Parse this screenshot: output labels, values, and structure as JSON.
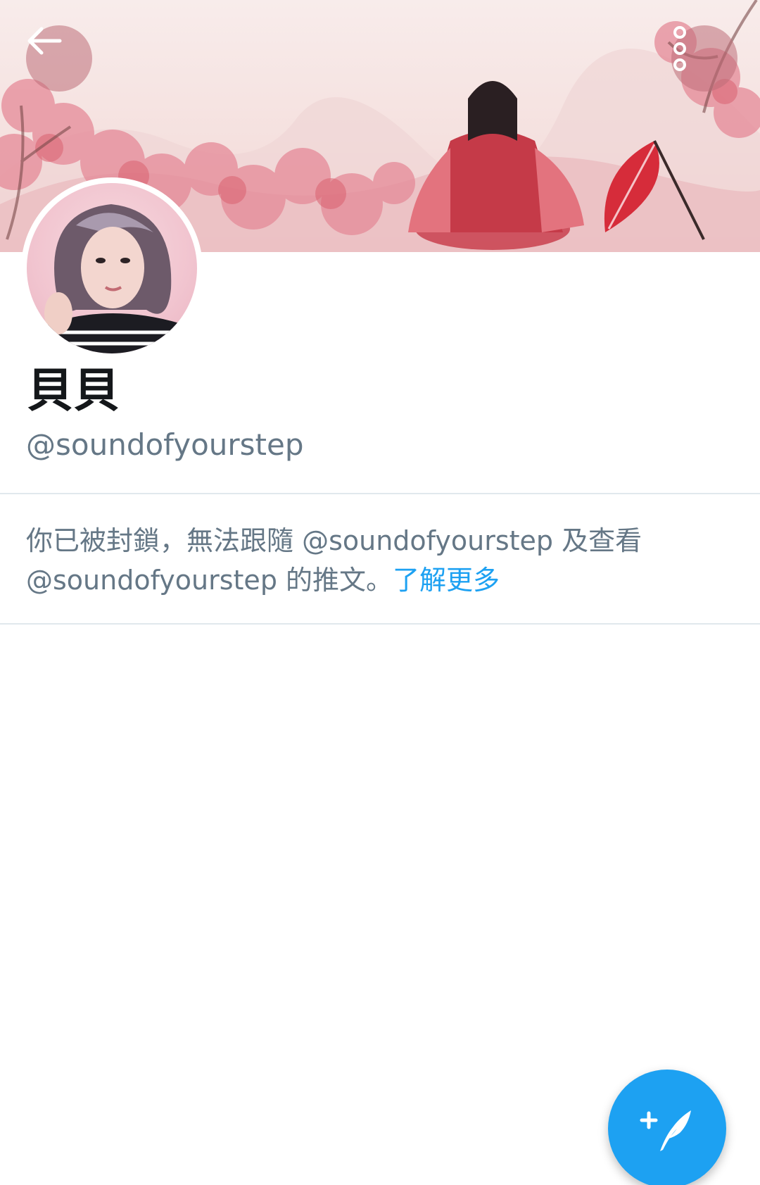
{
  "profile": {
    "display_name": "貝貝",
    "handle": "@soundofyourstep"
  },
  "notice": {
    "message": "你已被封鎖，無法跟隨 @soundofyourstep 及查看 @soundofyourstep 的推文。",
    "learn_more": "了解更多"
  },
  "icons": {
    "back": "arrow-left-icon",
    "more": "more-vertical-icon",
    "compose": "compose-tweet-icon"
  },
  "colors": {
    "accent": "#1da1f2",
    "secondary_text": "#657786",
    "primary_text": "#14171a",
    "divider": "#e1e8ed"
  }
}
